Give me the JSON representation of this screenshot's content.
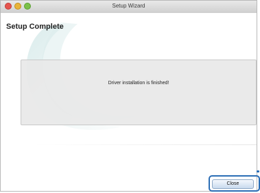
{
  "window": {
    "title": "Setup Wizard"
  },
  "page": {
    "heading": "Setup Complete"
  },
  "panel": {
    "message": "Driver installation is finished!"
  },
  "buttons": {
    "close_label": "Close"
  },
  "colors": {
    "highlight": "#2a6db5",
    "titlebar": "#d8d8d8",
    "panel": "#e8e8e8"
  }
}
